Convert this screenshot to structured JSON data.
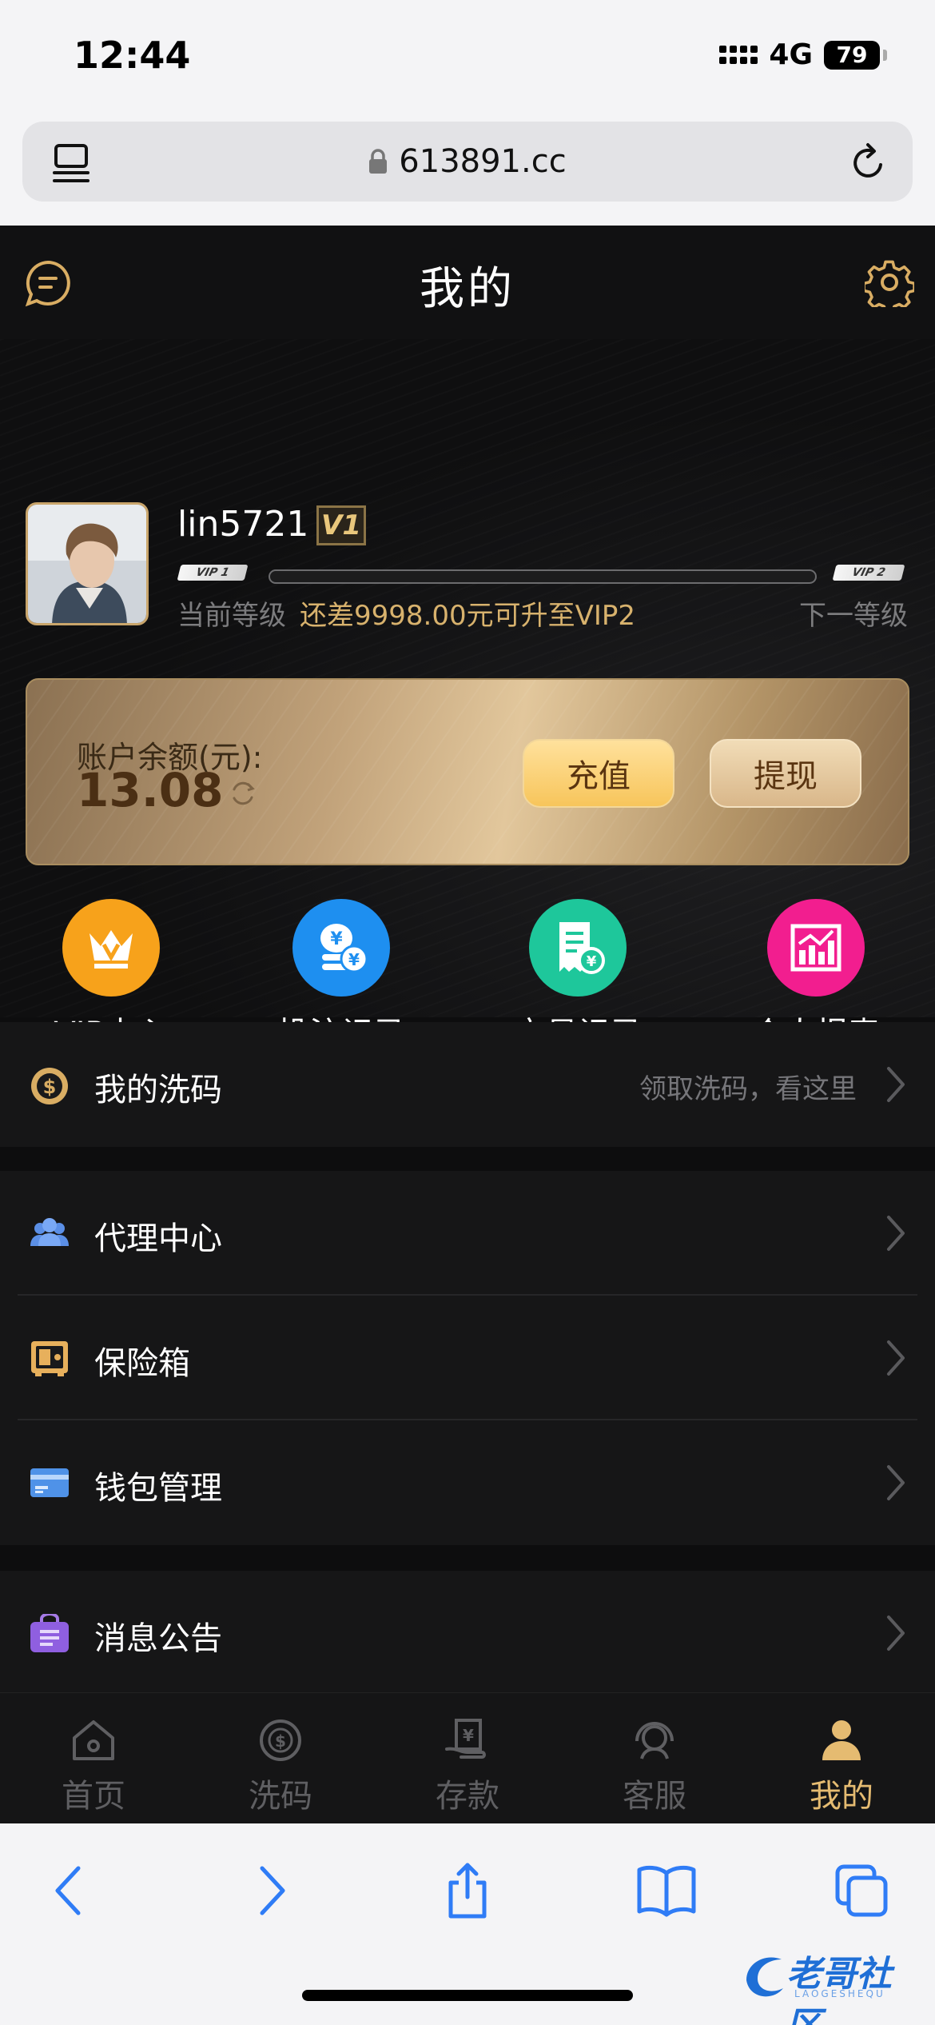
{
  "status_bar": {
    "time": "12:44",
    "network": "4G",
    "battery": "79"
  },
  "browser": {
    "url": "613891.cc"
  },
  "header": {
    "title": "我的"
  },
  "profile": {
    "username": "lin5721",
    "vip_badge": "V1",
    "current_tag": "VIP 1",
    "next_tag": "VIP 2",
    "current_level_label": "当前等级",
    "next_level_label": "下一等级",
    "upgrade_hint": "还差9998.00元可升至VIP2",
    "progress": 0
  },
  "balance": {
    "label": "账户余额(元):",
    "value": "13.08",
    "recharge_label": "充值",
    "withdraw_label": "提现"
  },
  "quick_actions": [
    {
      "label": "VIP中心",
      "icon": "crown-icon",
      "color": "#f7a21b"
    },
    {
      "label": "投注记录",
      "icon": "coins-icon",
      "color": "#1e8ff0"
    },
    {
      "label": "交易记录",
      "icon": "receipt-icon",
      "color": "#1ec79b"
    },
    {
      "label": "个人报表",
      "icon": "chart-icon",
      "color": "#f21e8f"
    }
  ],
  "menu": {
    "wash": {
      "label": "我的洗码",
      "hint": "领取洗码，看这里"
    },
    "agent": {
      "label": "代理中心"
    },
    "safe": {
      "label": "保险箱"
    },
    "wallet": {
      "label": "钱包管理"
    },
    "notice": {
      "label": "消息公告"
    }
  },
  "tabs": [
    {
      "label": "首页",
      "icon": "home-icon"
    },
    {
      "label": "洗码",
      "icon": "dollar-target-icon"
    },
    {
      "label": "存款",
      "icon": "deposit-icon"
    },
    {
      "label": "客服",
      "icon": "headset-icon"
    },
    {
      "label": "我的",
      "icon": "user-icon",
      "active": true
    }
  ],
  "watermark": {
    "text": "老哥社区",
    "sub": "LAOGESHEQU"
  },
  "colors": {
    "accent_gold": "#e5bb71",
    "background": "#0d0d0e"
  }
}
